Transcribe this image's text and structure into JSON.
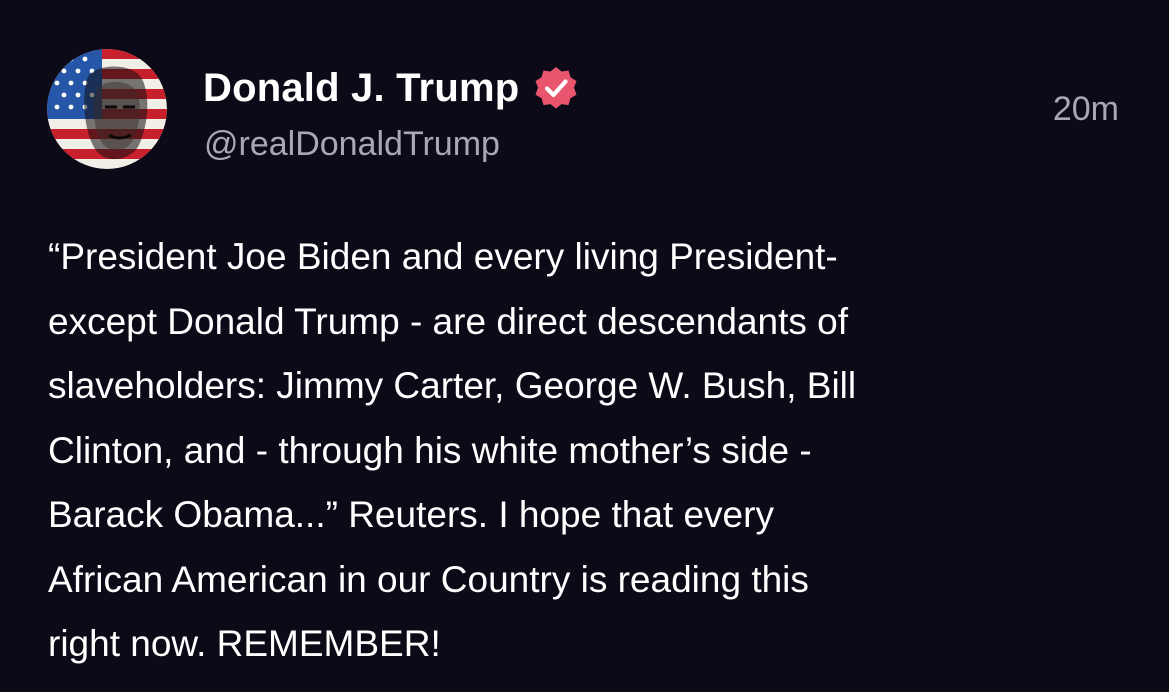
{
  "post": {
    "author": {
      "display_name": "Donald J. Trump",
      "handle": "@realDonaldTrump",
      "avatar_icon": "flag-portrait-avatar",
      "verified_icon": "verified-badge-icon"
    },
    "timestamp": "20m",
    "body": "“President Joe Biden and every living President-\nexcept Donald Trump - are direct descendants of\nslaveholders: Jimmy Carter, George W. Bush, Bill\nClinton, and - through his white mother’s side -\nBarack Obama...” Reuters. I hope that every\nAfrican American in our Country is reading this\nright now. REMEMBER!"
  },
  "colors": {
    "background": "#0c0a17",
    "text_primary": "#ffffff",
    "text_secondary": "#a9a6b6",
    "verified_badge": "#e8556d"
  }
}
